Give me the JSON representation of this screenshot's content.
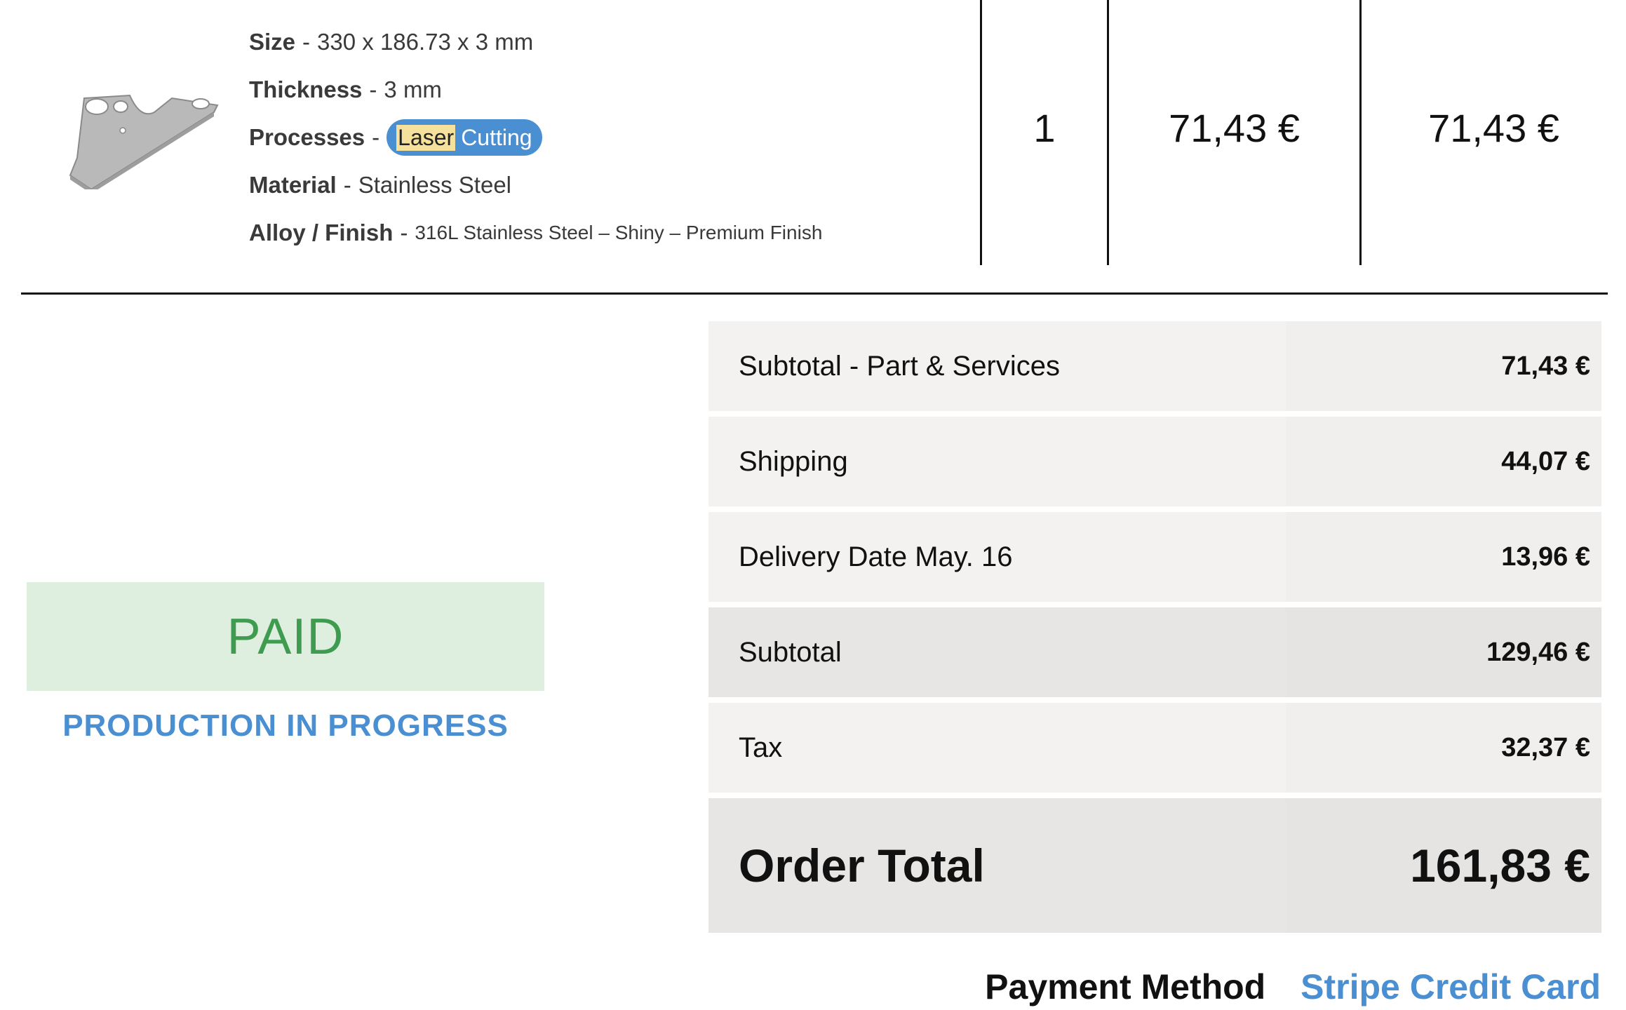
{
  "part": {
    "specs": {
      "size_key": "Size",
      "size_val": "330 x 186.73 x 3 mm",
      "thickness_key": "Thickness",
      "thickness_val": "3 mm",
      "processes_key": "Processes",
      "process_hl": "Laser",
      "process_rest": "Cutting",
      "material_key": "Material",
      "material_val": "Stainless Steel",
      "alloy_key": "Alloy / Finish",
      "alloy_val": "316L Stainless Steel – Shiny – Premium Finish"
    },
    "separator": "-",
    "quantity": "1",
    "unit_price": "71,43 €",
    "line_total": "71,43 €"
  },
  "status": {
    "payment_badge": "PAID",
    "production": "PRODUCTION IN PROGRESS"
  },
  "summary": {
    "rows": [
      {
        "label": "Subtotal - Part & Services",
        "amount": "71,43 €"
      },
      {
        "label": "Shipping",
        "amount": "44,07 €"
      },
      {
        "label": "Delivery Date May. 16",
        "amount": "13,96 €"
      },
      {
        "label": "Subtotal",
        "amount": "129,46 €"
      },
      {
        "label": "Tax",
        "amount": "32,37 €"
      }
    ],
    "total_label": "Order Total",
    "total_amount": "161,83 €"
  },
  "payment": {
    "label": "Payment Method",
    "value": "Stripe Credit Card"
  },
  "colors": {
    "accent_blue": "#4b8fd3",
    "paid_green": "#3e9b4f",
    "paid_bg": "#deefdf"
  }
}
